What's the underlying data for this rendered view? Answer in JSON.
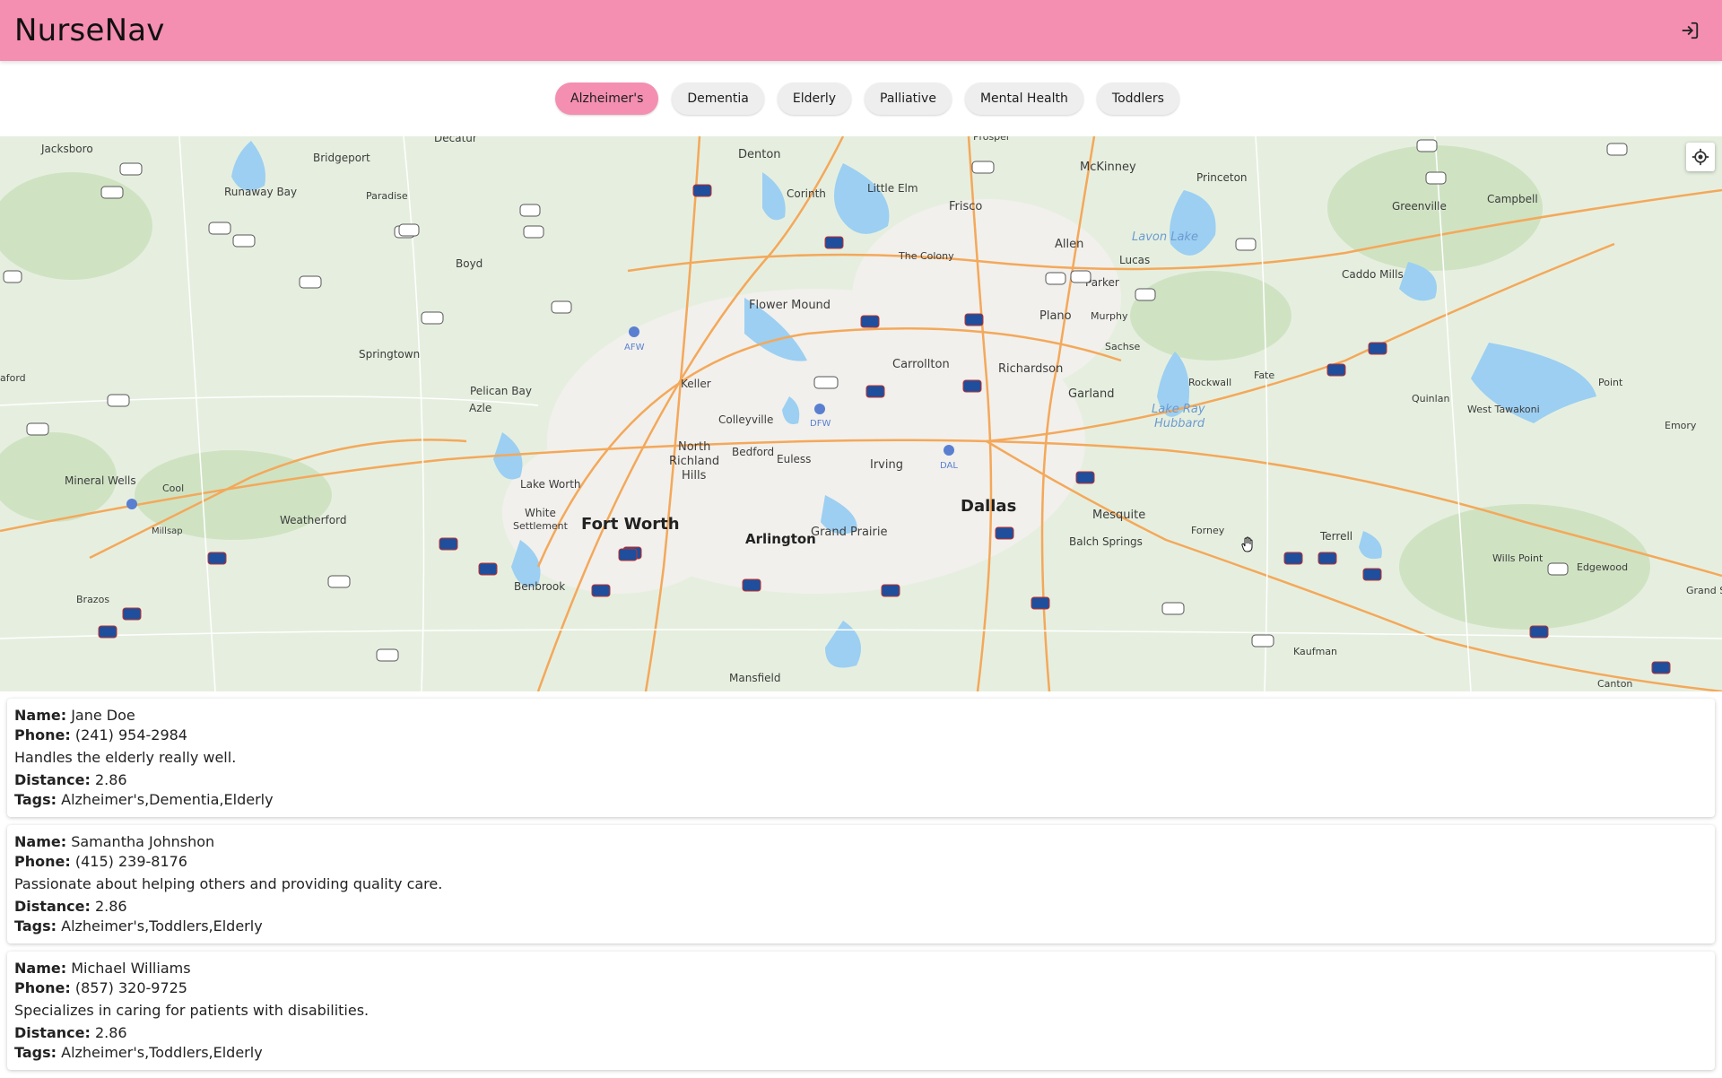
{
  "app": {
    "title": "NurseNav",
    "login_icon": "login-icon"
  },
  "filters": [
    {
      "label": "Alzheimer's",
      "active": true
    },
    {
      "label": "Dementia",
      "active": false
    },
    {
      "label": "Elderly",
      "active": false
    },
    {
      "label": "Palliative",
      "active": false
    },
    {
      "label": "Mental Health",
      "active": false
    },
    {
      "label": "Toddlers",
      "active": false
    }
  ],
  "map": {
    "locate_icon": "my-location-icon",
    "cities": [
      "Jacksboro",
      "Decatur",
      "Denton",
      "McKinney",
      "Princeton",
      "Greenville",
      "Campbell",
      "Bridgeport",
      "Runaway Bay",
      "Paradise",
      "Corinth",
      "Little Elm",
      "Frisco",
      "Allen",
      "Lavon Lake",
      "Lucas",
      "Caddo Mills",
      "The Colony",
      "Boyd",
      "Parker",
      "Flower Mound",
      "Murphy",
      "Plano",
      "Sachse",
      "Springtown",
      "Carrollton",
      "Richardson",
      "Rockwall",
      "Fate",
      "Keller",
      "Garland",
      "Point",
      "Quinlan",
      "West Tawakoni",
      "Pelican Bay",
      "Azle",
      "Colleyville",
      "Lake Ray Hubbard",
      "Emory",
      "North Richland Hills",
      "Bedford",
      "Euless",
      "Irving",
      "Mineral Wells",
      "Lake Worth",
      "Cool",
      "Dallas",
      "White Settlement",
      "Fort Worth",
      "Mesquite",
      "Forney",
      "Terrell",
      "Weatherford",
      "Millsap",
      "Arlington",
      "Grand Prairie",
      "Balch Springs",
      "Wills Point",
      "Edgewood",
      "Benbrook",
      "Brazos",
      "Kaufman",
      "Mansfield",
      "Canton",
      "Grand S",
      "aford",
      "Prosper"
    ]
  },
  "labels": {
    "name": "Name:",
    "phone": "Phone:",
    "distance": "Distance:",
    "tags": "Tags:"
  },
  "nurses": [
    {
      "name": "Jane Doe",
      "phone": "(241) 954-2984",
      "description": "Handles the elderly really well.",
      "distance": "2.86",
      "tags": "Alzheimer's,Dementia,Elderly"
    },
    {
      "name": "Samantha Johnshon",
      "phone": "(415) 239-8176",
      "description": "Passionate about helping others and providing quality care.",
      "distance": "2.86",
      "tags": "Alzheimer's,Toddlers,Elderly"
    },
    {
      "name": "Michael Williams",
      "phone": "(857) 320-9725",
      "description": "Specializes in caring for patients with disabilities.",
      "distance": "2.86",
      "tags": "Alzheimer's,Toddlers,Elderly"
    }
  ]
}
